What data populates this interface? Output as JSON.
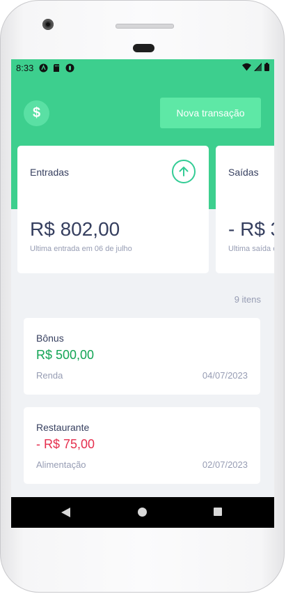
{
  "status_bar": {
    "time": "8:33"
  },
  "header": {
    "logo_symbol": "$",
    "new_transaction_label": "Nova transação"
  },
  "summary": {
    "entradas": {
      "title": "Entradas",
      "amount": "R$ 802,00",
      "subtitle": "Ultima entrada em 06 de julho",
      "icon": "arrow-up-circle-icon"
    },
    "saidas": {
      "title": "Saídas",
      "amount": "- R$ 3",
      "subtitle": "Ultima saída e"
    }
  },
  "items_count": "9 itens",
  "transactions": [
    {
      "title": "Bônus",
      "amount": "R$ 500,00",
      "type": "income",
      "category": "Renda",
      "date": "04/07/2023"
    },
    {
      "title": "Restaurante",
      "amount": "- R$ 75,00",
      "type": "outcome",
      "category": "Alimentação",
      "date": "02/07/2023"
    }
  ],
  "colors": {
    "header_green": "#3dcf8e",
    "button_green": "#5ee8a6",
    "income": "#12a454",
    "outcome": "#e52e4d",
    "text_title": "#363f5f",
    "text_muted": "#969cb3",
    "background": "#f0f2f5"
  }
}
